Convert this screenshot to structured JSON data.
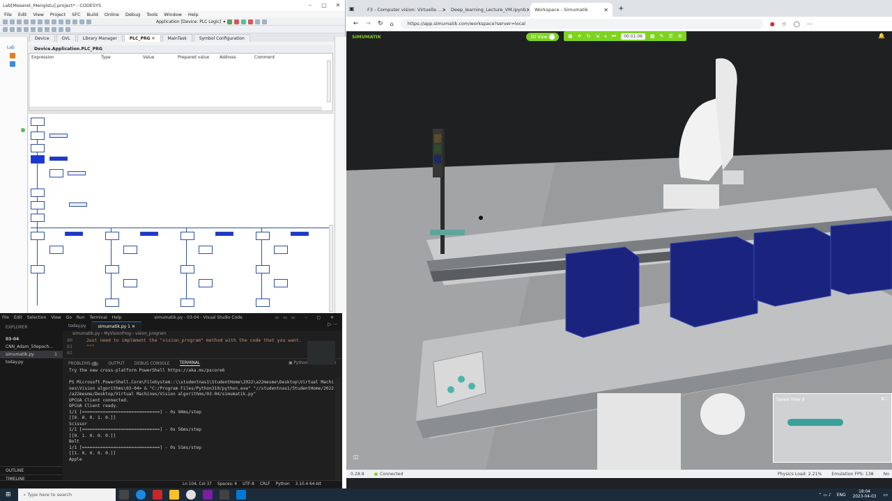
{
  "codesys": {
    "title": "Lab[Meseret_Mengistu].project* - CODESYS",
    "menu": [
      "File",
      "Edit",
      "View",
      "Project",
      "SFC",
      "Build",
      "Online",
      "Debug",
      "Tools",
      "Window",
      "Help"
    ],
    "app_target": "Application [Device: PLC Logic]",
    "tabs": [
      "Device",
      "GVL",
      "Library Manager",
      "PLC_PRG",
      "MainTask",
      "Symbol Configuration"
    ],
    "active_tab": "PLC_PRG",
    "tree_root": "Lab",
    "path": "Device.Application.PLC_PRG",
    "watch_columns": [
      "Expression",
      "Type",
      "Value",
      "Prepared value",
      "Address",
      "Comment"
    ]
  },
  "vscode": {
    "menu": [
      "File",
      "Edit",
      "Selection",
      "View",
      "Go",
      "Run",
      "Terminal",
      "Help"
    ],
    "title": "simumatik.py - 03-04 - Visual Studio Code",
    "explorer_label": "EXPLORER",
    "folder": "03-04",
    "files": [
      "CNN_Adam_50epoch...",
      "simumatik.py",
      "today.py"
    ],
    "selected_file_badge": "1",
    "outline": "OUTLINE",
    "timeline": "TIMELINE",
    "tabs": [
      "today.py",
      "simumatik.py 1"
    ],
    "breadcrumb": [
      "simumatik.py",
      "MyVisionProg",
      "vision_program"
    ],
    "code_lines": [
      {
        "num": "80",
        "text": "   Just need to implement the \"vision_program\" method with the code that you want."
      },
      {
        "num": "81",
        "text": "   \"\"\""
      },
      {
        "num": "82",
        "text": ""
      }
    ],
    "panel_tabs": [
      "PROBLEMS",
      "OUTPUT",
      "DEBUG CONSOLE",
      "TERMINAL"
    ],
    "problems_count": "1",
    "terminal_kind": "Python",
    "terminal": [
      "Try the new cross-platform PowerShell https://aka.ms/pscore6",
      "",
      "PS Microsoft.PowerShell.Core\\FileSystem::\\\\studentnas1\\StudentHome\\2022\\a22mesme\\Desktop\\Virtual Machi",
      "nes\\Vision algorithms\\03-04> & \"C:/Program Files/Python310/python.exe\" \"//studentnas1/StudentHome/2022",
      "/a22mesme/Desktop/Virtual Machines/Vision algorithms/03-04/simumatik.py\"",
      "OPCUA Client connected.",
      "OPCUA Client ready.",
      "1/1 [==============================] - 0s 94ms/step",
      "[[0. 0. 0. 1. 0.]]",
      "Scissor",
      "1/1 [==============================] - 0s 56ms/step",
      "[[0. 1. 0. 0. 0.]]",
      "Bolt",
      "1/1 [==============================] - 0s 51ms/step",
      "[[1. 0. 0. 0. 0.]]",
      "Apple"
    ],
    "status": [
      "Ln 104, Col 37",
      "Spaces: 4",
      "UTF-8",
      "CRLF",
      "Python",
      "3.10.4 64-bit"
    ]
  },
  "browser": {
    "tabs": [
      "F3 - Computer vision: Virtuella ...",
      "Deep_learning_Lecture_VM.ipynb",
      "Workspace - Simumatik"
    ],
    "url": "https://app.simumatik.com/workspace?server=local",
    "logo": "SIMUMATIK",
    "view_toggle": "3D View",
    "timer": "00:01:06",
    "saved_view": "Saved View 9",
    "version": "0.28.8",
    "connection": "Connected",
    "physics_load": "Physics Load: 2.21%",
    "emulation_fps": "Emulation FPS: 138",
    "trailing": "No"
  },
  "taskbar": {
    "search_placeholder": "Type here to search",
    "lang": "ENG",
    "time": "18:04",
    "date": "2023-04-03"
  },
  "colors": {
    "sim_green": "#7ed321",
    "vscode_blue": "#0078d4",
    "sfc_active": "#1d36d6",
    "bin_blue": "#1a237e"
  }
}
